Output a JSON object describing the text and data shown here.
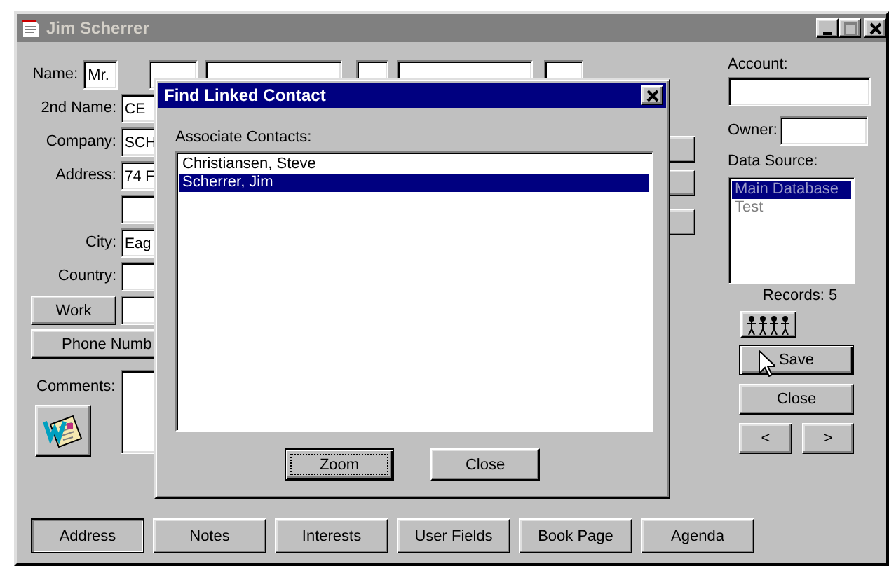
{
  "window": {
    "title": "Jim Scherrer",
    "active": false
  },
  "form": {
    "rows": [
      {
        "kind": "name",
        "label": "Name:",
        "value": "Mr."
      },
      {
        "kind": "field",
        "label": "2nd Name:",
        "value": "CE"
      },
      {
        "kind": "field",
        "label": "Company:",
        "value": "SCH"
      },
      {
        "kind": "field",
        "label": "Address:",
        "value": "74 F"
      },
      {
        "kind": "blank"
      },
      {
        "kind": "field",
        "label": "City:",
        "value": "Eag"
      },
      {
        "kind": "field",
        "label": "Country:"
      },
      {
        "kind": "button-field",
        "label": "Work"
      },
      {
        "kind": "wide-button",
        "label": "Phone Numb"
      },
      {
        "kind": "comments",
        "label": "Comments:"
      }
    ]
  },
  "side": {
    "account_label": "Account:",
    "owner_label": "Owner:",
    "source_label": "Data Source:",
    "source_disabled": true,
    "sources": [
      {
        "label": "Main Database",
        "selected": true
      },
      {
        "label": "Test",
        "selected": false
      }
    ],
    "records": "Records: 5",
    "buttons": [
      {
        "label": "Save",
        "default": true
      },
      {
        "label": "Close",
        "default": false
      }
    ],
    "prev": "<",
    "next": ">"
  },
  "tabs": [
    {
      "label": "Address",
      "selected": true
    },
    {
      "label": "Notes",
      "selected": false
    },
    {
      "label": "Interests",
      "selected": false
    },
    {
      "label": "User Fields",
      "selected": false
    },
    {
      "label": "Book Page",
      "selected": false
    },
    {
      "label": "Agenda",
      "selected": false
    }
  ],
  "dialog": {
    "title": "Find Linked Contact",
    "list_label": "Associate Contacts:",
    "contacts": [
      {
        "label": "Christiansen, Steve",
        "selected": false
      },
      {
        "label": "Scherrer, Jim",
        "selected": true
      }
    ],
    "buttons": [
      {
        "label": "Zoom",
        "focused": true
      },
      {
        "label": "Close",
        "focused": false
      }
    ]
  }
}
